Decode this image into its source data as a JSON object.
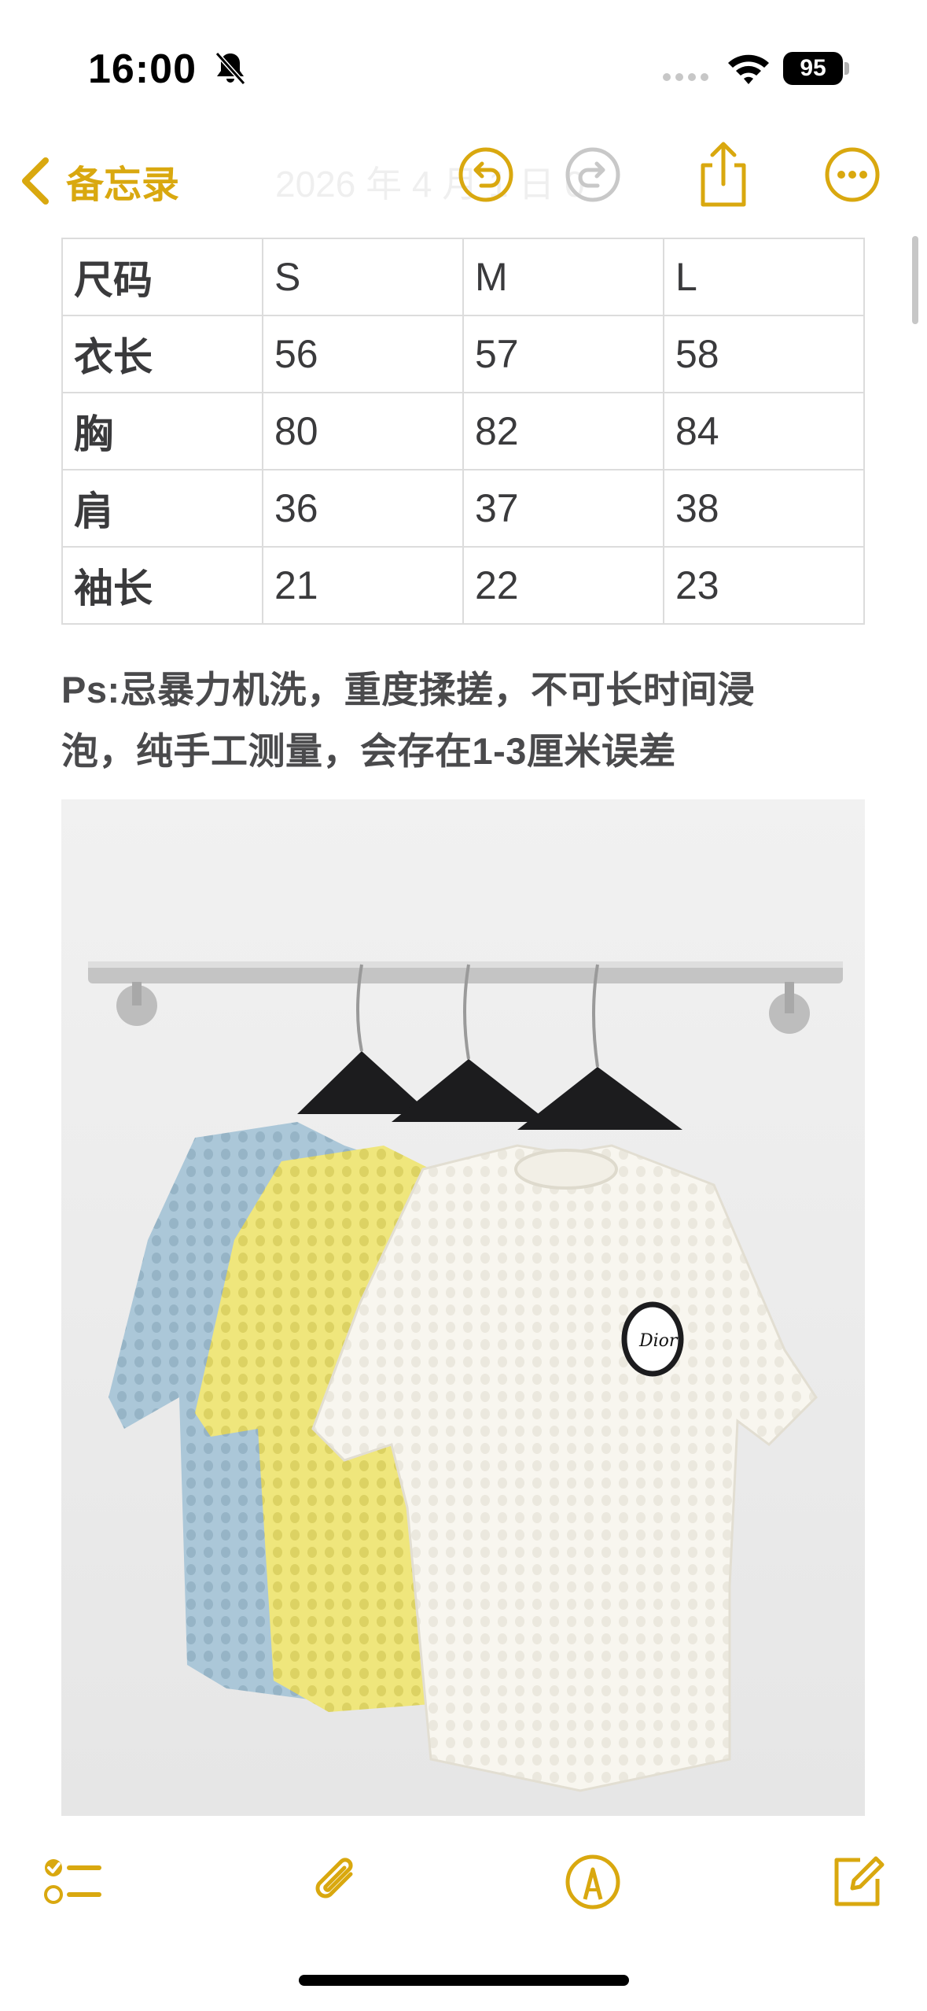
{
  "status_bar": {
    "time": "16:00",
    "battery": "95",
    "icons": [
      "bell-slash-icon",
      "cellular-icon",
      "wifi-icon",
      "battery-icon"
    ]
  },
  "nav": {
    "back_label": "备忘录",
    "ghost_title": "2026 年 4 月 1 日 0",
    "accent": "#D9A80F",
    "icons": [
      "chevron-left-icon",
      "undo-icon",
      "redo-icon",
      "share-icon",
      "more-icon"
    ]
  },
  "table": {
    "rows": [
      [
        "尺码",
        "S",
        "M",
        "L"
      ],
      [
        "衣长",
        "56",
        "57",
        "58"
      ],
      [
        "胸",
        "80",
        "82",
        "84"
      ],
      [
        "肩",
        "36",
        "37",
        "38"
      ],
      [
        "袖长",
        "21",
        "22",
        "23"
      ]
    ]
  },
  "note": {
    "line1": "Ps:忌暴力机洗，重度揉搓，不可长时间浸",
    "line2": "泡，纯手工测量，会存在1-3厘米误差"
  },
  "photo": {
    "brand_mark": "Dior",
    "shirt_colors": [
      "#a9c5d6",
      "#ece47a",
      "#f7f5ee"
    ]
  },
  "toolbar": {
    "icons": [
      "checklist-icon",
      "paperclip-icon",
      "markup-pen-icon",
      "compose-icon"
    ]
  }
}
